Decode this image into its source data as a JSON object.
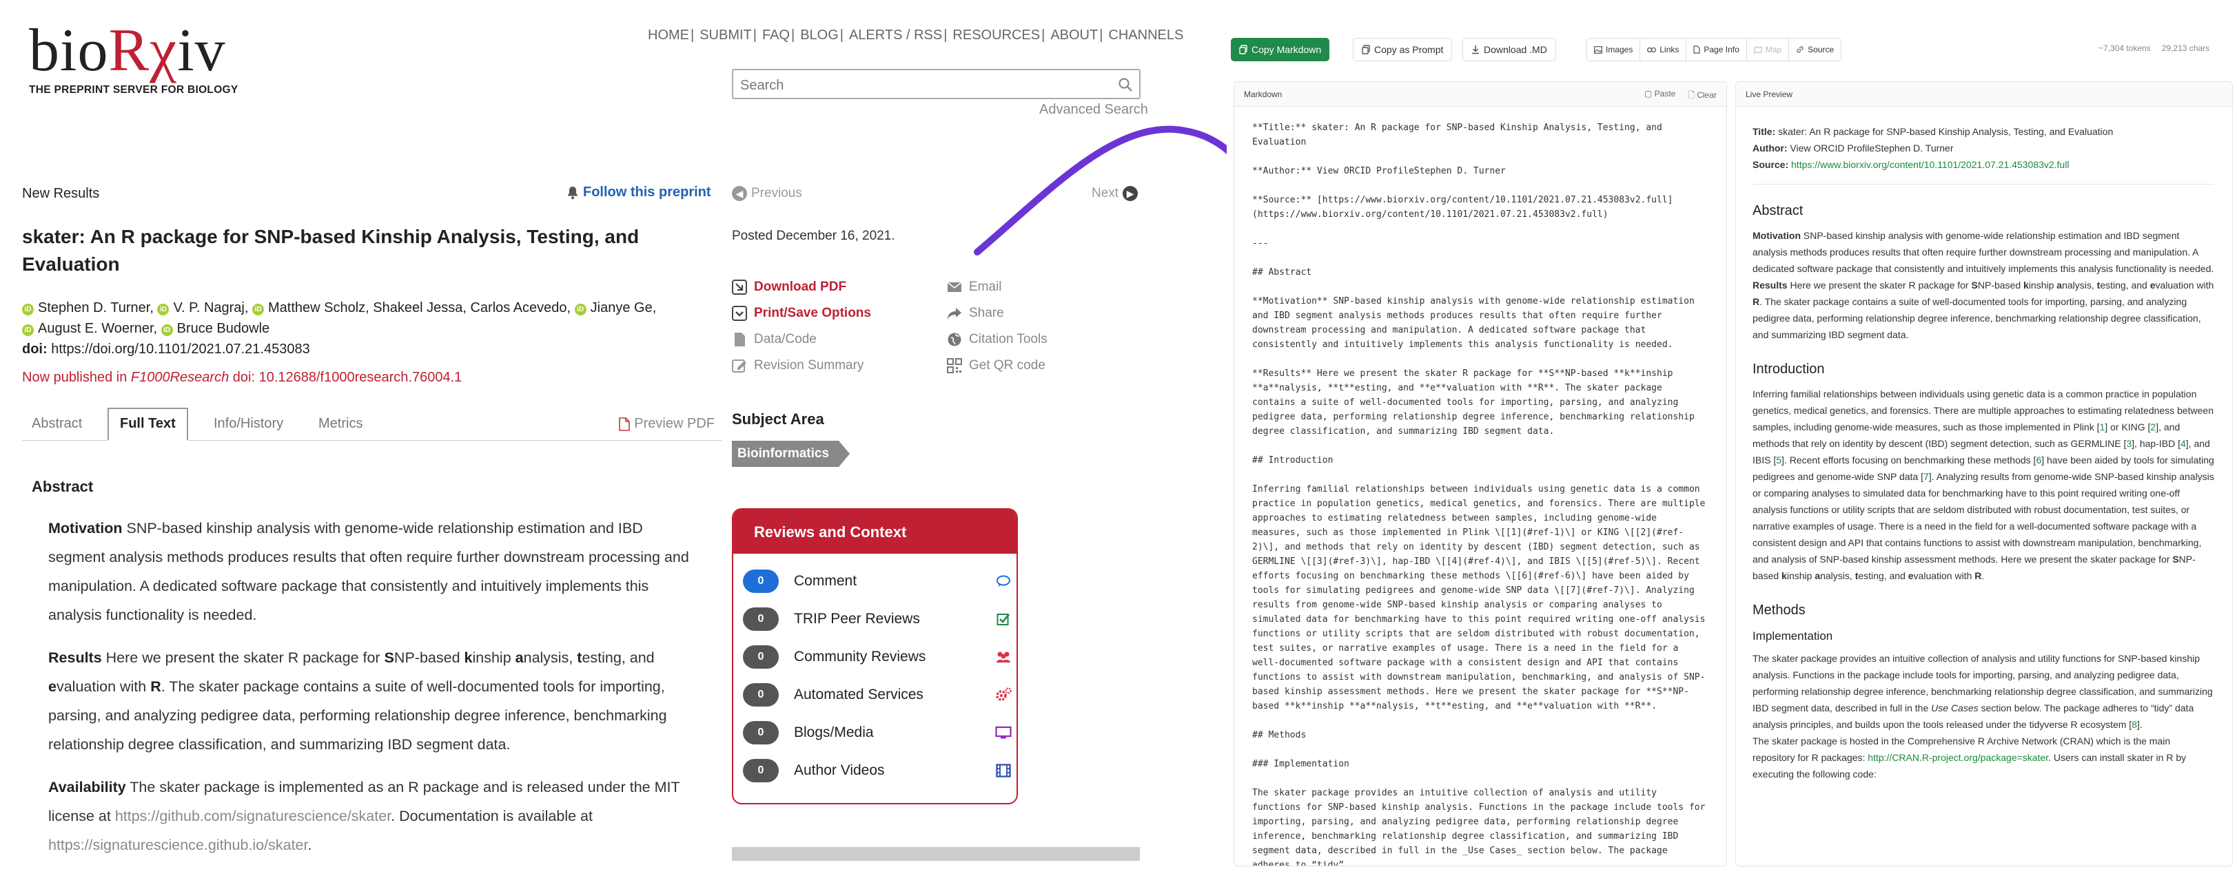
{
  "site": {
    "logo_main_pre": "bio",
    "logo_main_rx": "Rχ",
    "logo_main_post": "iv",
    "logo_tagline": "THE PREPRINT SERVER FOR BIOLOGY",
    "nav": [
      "HOME",
      "SUBMIT",
      "FAQ",
      "BLOG",
      "ALERTS / RSS",
      "RESOURCES",
      "ABOUT",
      "CHANNELS"
    ],
    "search_placeholder": "Search",
    "advanced_search": "Advanced Search"
  },
  "article": {
    "category": "New Results",
    "follow": "Follow this preprint",
    "previous": "Previous",
    "next": "Next",
    "title": "skater: An R package for SNP-based Kinship Analysis, Testing, and Evaluation",
    "authors_line1": [
      "Stephen D. Turner,",
      "V. P. Nagraj,",
      "Matthew Scholz, Shakeel Jessa, Carlos Acevedo,",
      "Jianye Ge,"
    ],
    "authors_line2": [
      "August E. Woerner,",
      "Bruce Budowle"
    ],
    "doi_label": "doi:",
    "doi_value": "https://doi.org/10.1101/2021.07.21.453083",
    "published_prefix": "Now published in",
    "published_journal": "F1000Research",
    "published_doi": "doi: 10.12688/f1000research.76004.1",
    "tabs": [
      "Abstract",
      "Full Text",
      "Info/History",
      "Metrics"
    ],
    "active_tab": "Full Text",
    "preview_pdf": "Preview PDF",
    "abstract_heading": "Abstract",
    "motivation_label": "Motivation",
    "motivation_text": " SNP-based kinship analysis with genome-wide relationship estimation and IBD segment analysis methods produces results that often require further downstream processing and manipulation. A dedicated software package that consistently and intuitively implements this analysis functionality is needed.",
    "results_label": "Results",
    "results_text_a": " Here we present the skater R package for ",
    "results_text_b": "NP-based ",
    "results_text_c": "inship ",
    "results_text_d": "nalysis, ",
    "results_text_e": "esting, and ",
    "results_text_f": "valuation with ",
    "results_text_g": ". The skater package contains a suite of well-documented tools for importing, parsing, and analyzing pedigree data, performing relationship degree inference, benchmarking relationship degree classification, and summarizing IBD segment data.",
    "results_bold": [
      "S",
      "k",
      "a",
      "t",
      "e",
      "R"
    ],
    "availability_label": "Availability",
    "availability_text": " The skater package is implemented as an R package and is released under the MIT license at ",
    "availability_link1": "https://github.com/signaturescience/skater",
    "availability_text2": ". Documentation is available at ",
    "availability_link2": "https://signaturescience.github.io/skater",
    "availability_end": "."
  },
  "sidebar": {
    "posted": "Posted December 16, 2021.",
    "actions_left": [
      "Download PDF",
      "Print/Save Options",
      "Data/Code",
      "Revision Summary"
    ],
    "actions_right": [
      "Email",
      "Share",
      "Citation Tools",
      "Get QR code"
    ],
    "subject_heading": "Subject Area",
    "subject_tag": "Bioinformatics",
    "reviews_heading": "Reviews and Context",
    "reviews": [
      {
        "count": "0",
        "label": "Comment"
      },
      {
        "count": "0",
        "label": "TRIP Peer Reviews"
      },
      {
        "count": "0",
        "label": "Community Reviews"
      },
      {
        "count": "0",
        "label": "Automated Services"
      },
      {
        "count": "0",
        "label": "Blogs/Media"
      },
      {
        "count": "0",
        "label": "Author Videos"
      }
    ]
  },
  "app": {
    "copy_markdown": "Copy Markdown",
    "copy_prompt": "Copy as Prompt",
    "download_md": "Download .MD",
    "view_tabs": [
      "Images",
      "Links",
      "Page Info",
      "Map",
      "Source"
    ],
    "tokens": "~7,304 tokens",
    "chars": "29,213 chars",
    "markdown_panel_title": "Markdown",
    "paste": "Paste",
    "clear": "Clear",
    "preview_panel_title": "Live Preview",
    "markdown_text": "**Title:** skater: An R package for SNP-based Kinship Analysis, Testing, and Evaluation\n\n**Author:** View ORCID ProfileStephen D. Turner\n\n**Source:** [https://www.biorxiv.org/content/10.1101/2021.07.21.453083v2.full](https://www.biorxiv.org/content/10.1101/2021.07.21.453083v2.full)\n\n---\n\n## Abstract\n\n**Motivation** SNP-based kinship analysis with genome-wide relationship estimation and IBD segment analysis methods produces results that often require further downstream processing and manipulation. A dedicated software package that consistently and intuitively implements this analysis functionality is needed.\n\n**Results** Here we present the skater R package for **S**NP-based **k**inship **a**nalysis, **t**esting, and **e**valuation with **R**. The skater package contains a suite of well-documented tools for importing, parsing, and analyzing pedigree data, performing relationship degree inference, benchmarking relationship degree classification, and summarizing IBD segment data.\n\n## Introduction\n\nInferring familial relationships between individuals using genetic data is a common practice in population genetics, medical genetics, and forensics. There are multiple approaches to estimating relatedness between samples, including genome-wide measures, such as those implemented in Plink \\[[1](#ref-1)\\] or KING \\[[2](#ref-2)\\], and methods that rely on identity by descent (IBD) segment detection, such as GERMLINE \\[[3](#ref-3)\\], hap-IBD \\[[4](#ref-4)\\], and IBIS \\[[5](#ref-5)\\]. Recent efforts focusing on benchmarking these methods \\[[6](#ref-6)\\] have been aided by tools for simulating pedigrees and genome-wide SNP data \\[[7](#ref-7)\\]. Analyzing results from genome-wide SNP-based kinship analysis or comparing analyses to simulated data for benchmarking have to this point required writing one-off analysis functions or utility scripts that are seldom distributed with robust documentation, test suites, or narrative examples of usage. There is a need in the field for a well-documented software package with a consistent design and API that contains functions to assist with downstream manipulation, benchmarking, and analysis of SNP-based kinship assessment methods. Here we present the skater package for **S**NP-based **k**inship **a**nalysis, **t**esting, and **e**valuation with **R**.\n\n## Methods\n\n### Implementation\n\nThe skater package provides an intuitive collection of analysis and utility functions for SNP-based kinship analysis. Functions in the package include tools for importing, parsing, and analyzing pedigree data, performing relationship degree inference, benchmarking relationship degree classification, and summarizing IBD segment data, described in full in the _Use Cases_ section below. The package adheres to “tidy”",
    "preview": {
      "title_label": "Title:",
      "title_value": " skater: An R package for SNP-based Kinship Analysis, Testing, and Evaluation",
      "author_label": "Author:",
      "author_value": " View ORCID ProfileStephen D. Turner",
      "source_label": "Source:",
      "source_value": "https://www.biorxiv.org/content/10.1101/2021.07.21.453083v2.full",
      "abstract_h": "Abstract",
      "motivation_label": "Motivation",
      "motivation_text": " SNP-based kinship analysis with genome-wide relationship estimation and IBD segment analysis methods produces results that often require further downstream processing and manipulation. A dedicated software package that consistently and intuitively implements this analysis functionality is needed.",
      "results_label": "Results",
      "results_a": " Here we present the skater R package for ",
      "results_b": "NP-based ",
      "results_c": "inship ",
      "results_d": "nalysis, ",
      "results_e": "esting, and ",
      "results_f": "valuation with ",
      "results_g": ". The skater package contains a suite of well-documented tools for importing, parsing, and analyzing pedigree data, performing relationship degree inference, benchmarking relationship degree classification, and summarizing IBD segment data.",
      "intro_h": "Introduction",
      "intro_1": "Inferring familial relationships between individuals using genetic data is a common practice in population genetics, medical genetics, and forensics. There are multiple approaches to estimating relatedness between samples, including genome-wide measures, such as those implemented in Plink [",
      "ref1": "1",
      "intro_2": "] or KING [",
      "ref2": "2",
      "intro_3": "], and methods that rely on identity by descent (IBD) segment detection, such as GERMLINE [",
      "ref3": "3",
      "intro_4": "], hap-IBD [",
      "ref4": "4",
      "intro_5": "], and IBIS [",
      "ref5": "5",
      "intro_6": "]. Recent efforts focusing on benchmarking these methods [",
      "ref6": "6",
      "intro_7": "] have been aided by tools for simulating pedigrees and genome-wide SNP data [",
      "ref7": "7",
      "intro_8": "]. Analyzing results from genome-wide SNP-based kinship analysis or comparing analyses to simulated data for benchmarking have to this point required writing one-off analysis functions or utility scripts that are seldom distributed with robust documentation, test suites, or narrative examples of usage. There is a need in the field for a well-documented software package with a consistent design and API that contains functions to assist with downstream manipulation, benchmarking, and analysis of SNP-based kinship assessment methods. Here we present the skater package for ",
      "intro_9": "NP-based ",
      "intro_10": "inship ",
      "intro_11": "nalysis, ",
      "intro_12": "esting, and ",
      "intro_13": "valuation with ",
      "intro_14": ".",
      "methods_h": "Methods",
      "impl_h": "Implementation",
      "impl_1": "The skater package provides an intuitive collection of analysis and utility functions for SNP-based kinship analysis. Functions in the package include tools for importing, parsing, and analyzing pedigree data, performing relationship degree inference, benchmarking relationship degree classification, and summarizing IBD segment data, described in full in the ",
      "impl_em": "Use Cases",
      "impl_2": " section below. The package adheres to “tidy” data analysis principles, and builds upon the tools released under the tidyverse R ecosystem [",
      "ref8": "8",
      "impl_3": "].",
      "impl_4": "The skater package is hosted in the Comprehensive R Archive Network (CRAN) which is the main repository for R packages: ",
      "cran_link": "http://CRAN.R-project.org/package=skater",
      "impl_5": ". Users can install skater in R by executing the following code:"
    }
  },
  "colors": {
    "brand_red": "#bf2033",
    "link_blue": "#1f61b3",
    "app_green": "#1f8a4a",
    "arrow_purple": "#6b35d6"
  }
}
